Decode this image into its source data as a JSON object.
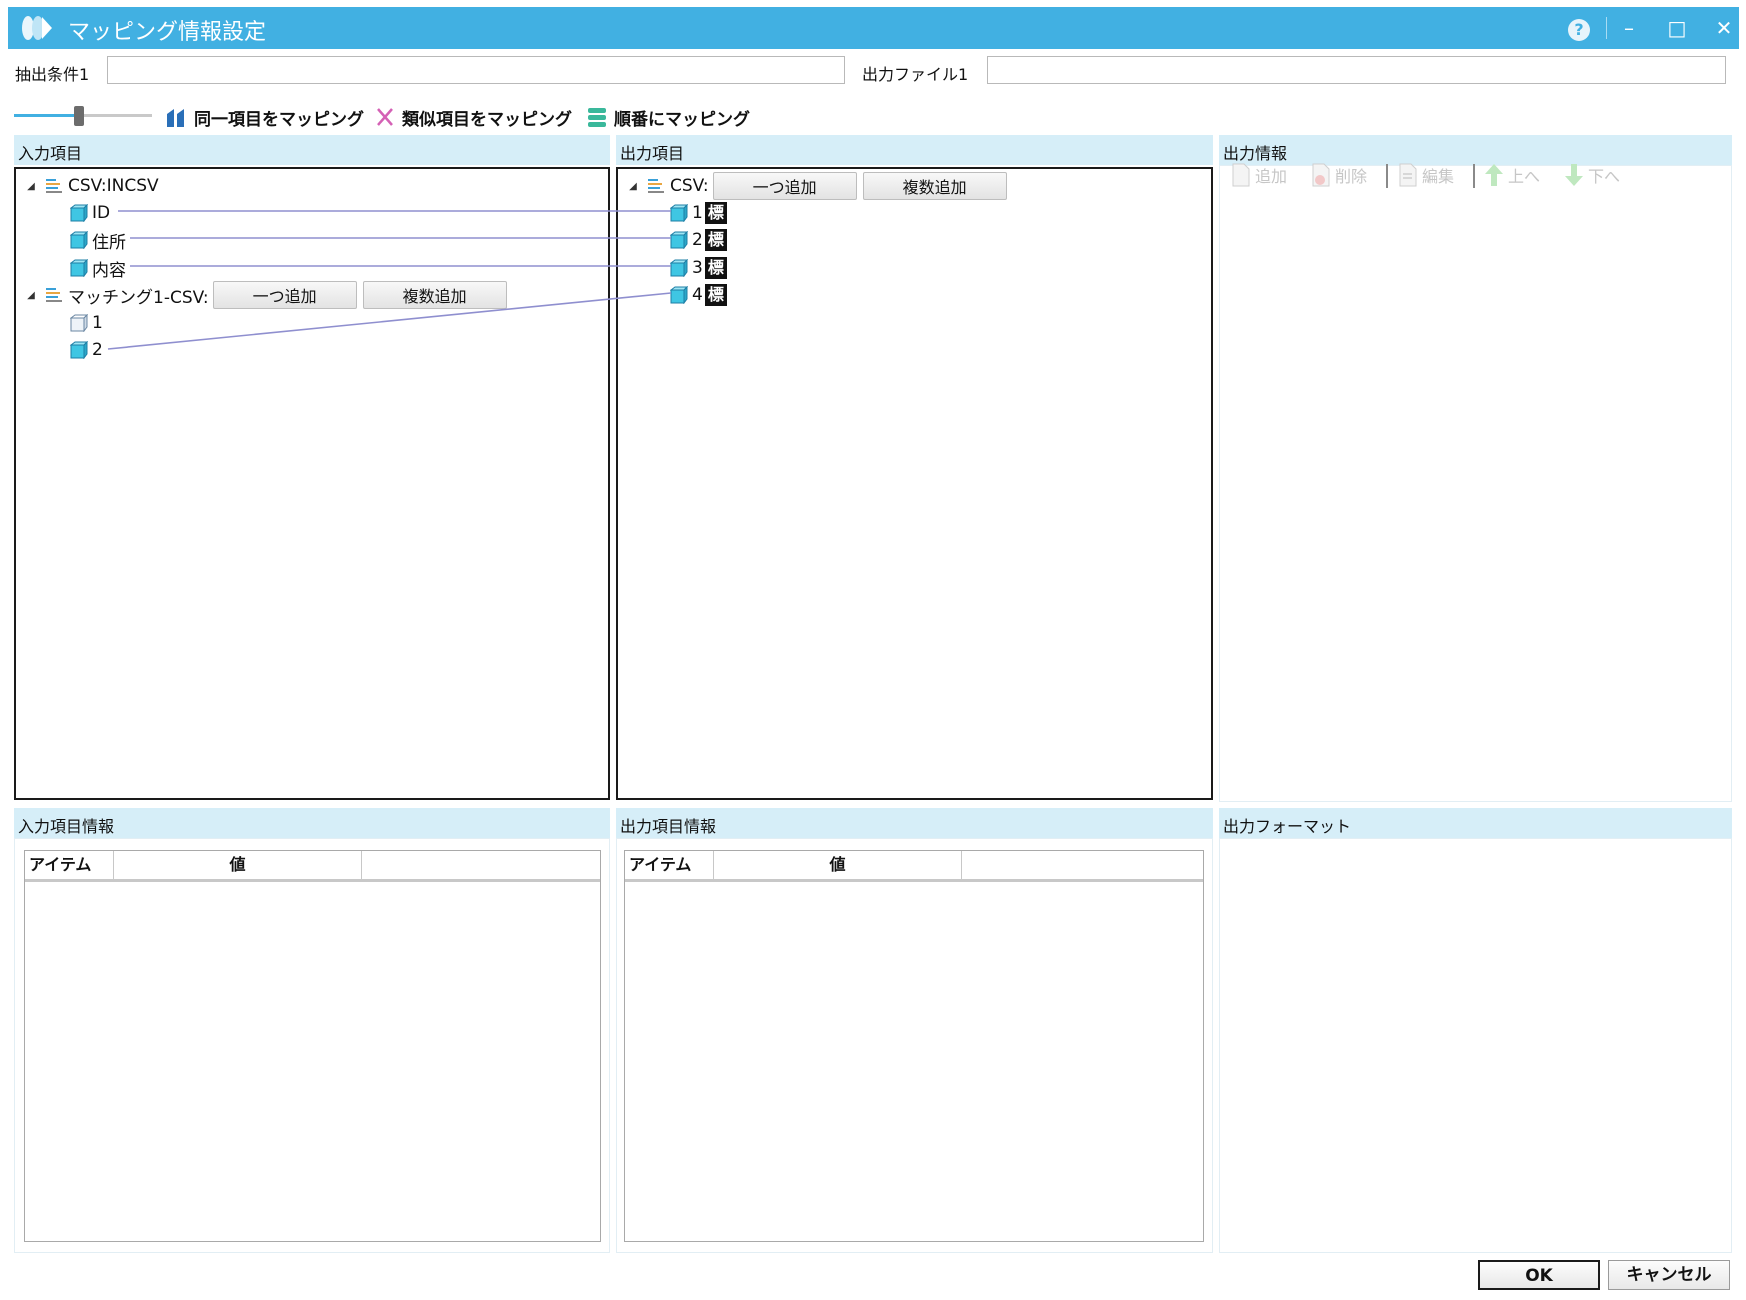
{
  "window": {
    "title": "マッピング情報設定",
    "help_icon": "?",
    "minimize_icon": "–",
    "maximize_icon": "□",
    "close_icon": "✕"
  },
  "filters": {
    "extract_label": "抽出条件1",
    "extract_value": "",
    "output_file_label": "出力ファイル1",
    "output_file_value": ""
  },
  "toolbar": {
    "map_same": "同一項目をマッピング",
    "map_similar": "類似項目をマッピング",
    "map_order": "順番にマッピング"
  },
  "input_panel": {
    "header": "入力項目",
    "groups": [
      {
        "label": "CSV:INCSV",
        "items": [
          "ID",
          "住所",
          "内容"
        ]
      },
      {
        "label": "マッチング1-CSV:",
        "add_one": "一つ追加",
        "add_multi": "複数追加",
        "items": [
          "1",
          "2"
        ]
      }
    ]
  },
  "output_panel": {
    "header": "出力項目",
    "group_label": "CSV:",
    "add_one": "一つ追加",
    "add_multi": "複数追加",
    "items": [
      "1",
      "2",
      "3",
      "4"
    ],
    "tag_glyph": "標"
  },
  "output_info": {
    "header": "出力情報",
    "buttons": {
      "add": "追加",
      "delete": "削除",
      "edit": "編集",
      "up": "上へ",
      "down": "下へ"
    }
  },
  "input_item_info": {
    "header": "入力項目情報",
    "columns": [
      "アイテム",
      "値",
      ""
    ]
  },
  "output_item_info": {
    "header": "出力項目情報",
    "columns": [
      "アイテム",
      "値",
      ""
    ]
  },
  "output_format": {
    "header": "出力フォーマット"
  },
  "footer": {
    "ok": "OK",
    "cancel": "キャンセル"
  },
  "mappings": [
    {
      "from": "ID",
      "to": "1"
    },
    {
      "from": "住所",
      "to": "2"
    },
    {
      "from": "内容",
      "to": "3"
    },
    {
      "from": "2",
      "to": "4"
    }
  ],
  "colors": {
    "titlebar": "#41b0e2",
    "panel_header": "#d6eef8",
    "mapping_line": "#8f8fcf"
  }
}
